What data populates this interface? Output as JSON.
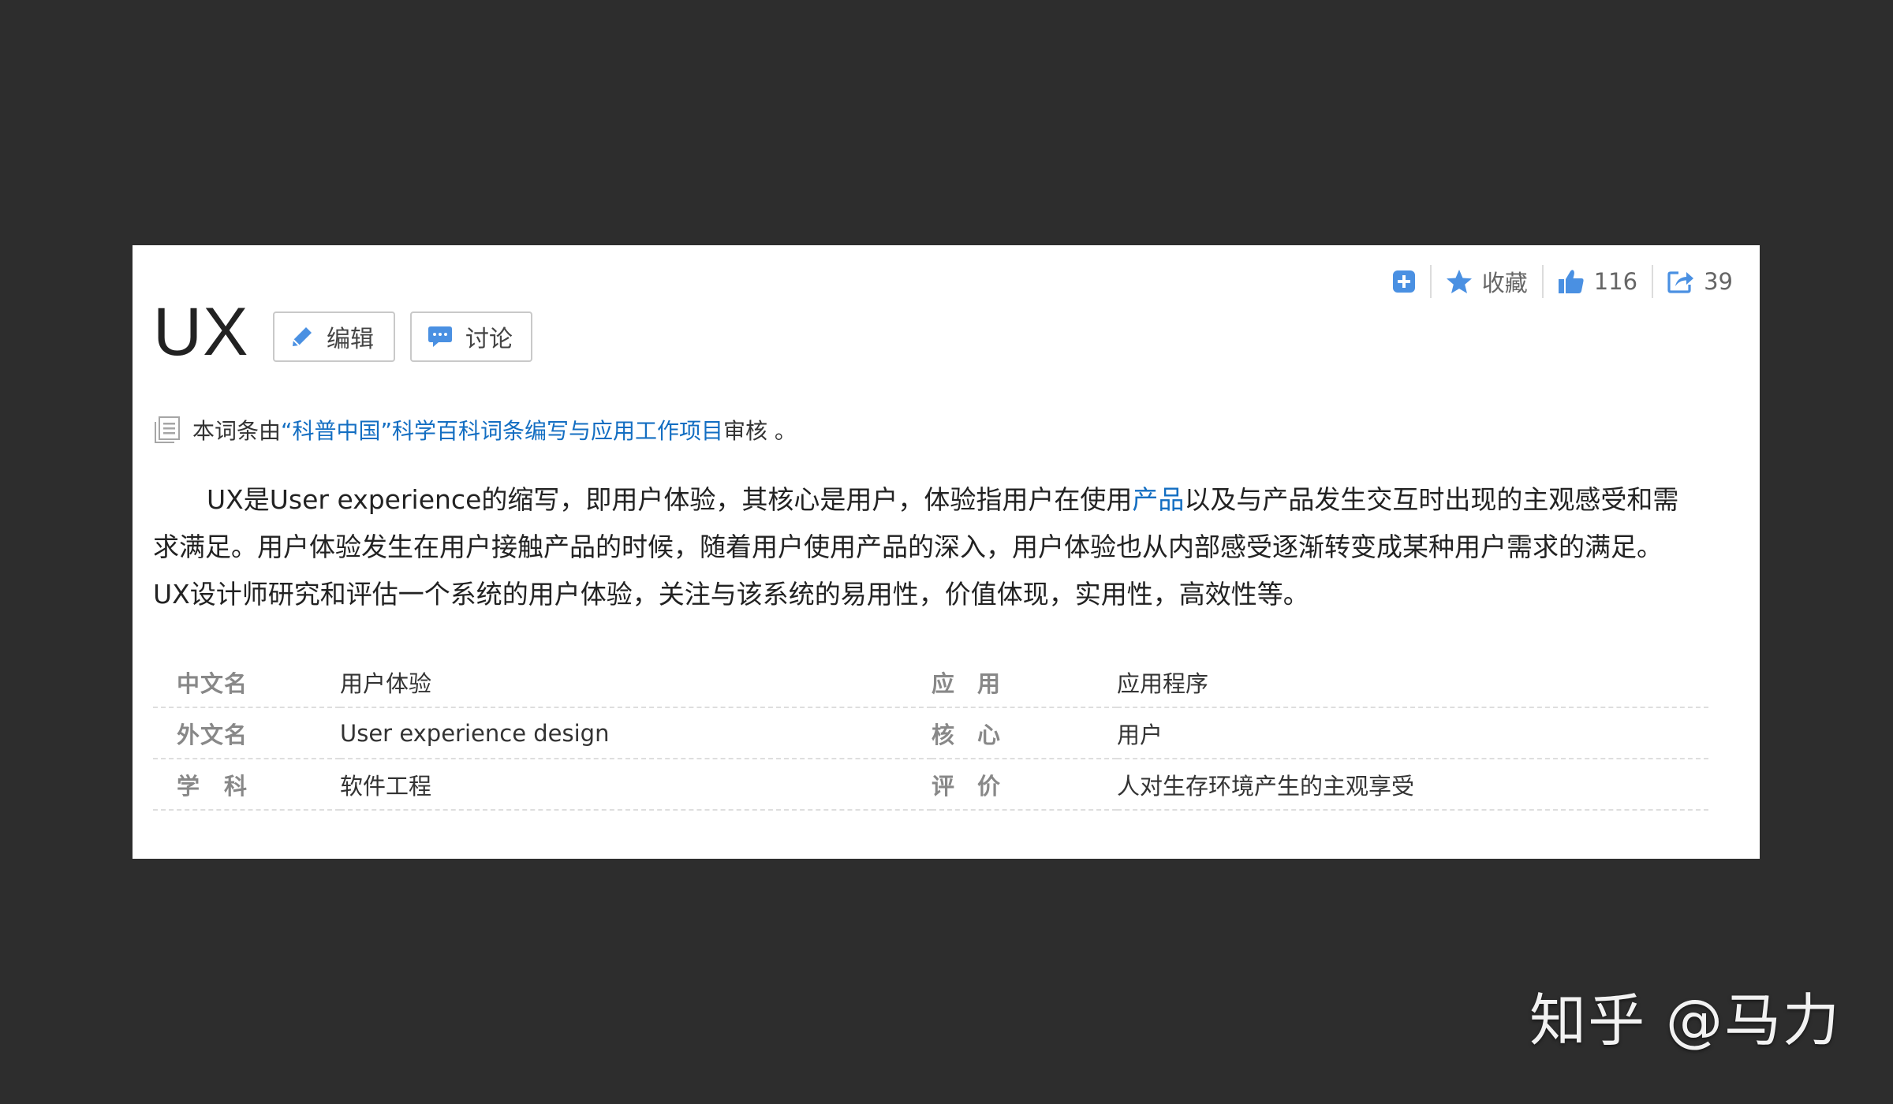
{
  "toolbar": {
    "favorite_label": "收藏",
    "like_count": "116",
    "share_count": "39"
  },
  "entry": {
    "title": "UX",
    "edit_label": "编辑",
    "discuss_label": "讨论"
  },
  "review": {
    "prefix": "本词条由",
    "link_text": "“科普中国”科学百科词条编写与应用工作项目",
    "suffix": " 审核 。"
  },
  "summary": {
    "part1": "UX是User experience的缩写，即用户体验，其核心是用户，体验指用户在使用",
    "link_text": "产品",
    "part2": "以及与产品发生交互时出现的主观感受和需求满足。用户体验发生在用户接触产品的时候，随着用户使用产品的深入，用户体验也从内部感受逐渐转变成某种用户需求的满足。UX设计师研究和评估一个系统的用户体验，关注与该系统的易用性，价值体现，实用性，高效性等。"
  },
  "info": {
    "rows": [
      {
        "k1": "中文名",
        "v1": "用户体验",
        "k2": "应　用",
        "v2": "应用程序"
      },
      {
        "k1": "外文名",
        "v1": "User experience design",
        "k2": "核　心",
        "v2": "用户"
      },
      {
        "k1": "学　科",
        "v1": "软件工程",
        "k2": "评　价",
        "v2": "人对生存环境产生的主观享受"
      }
    ]
  },
  "watermark": "知乎 @马力",
  "colors": {
    "accent": "#4a90e2",
    "link": "#136ec2",
    "background": "#2d2d2d"
  }
}
